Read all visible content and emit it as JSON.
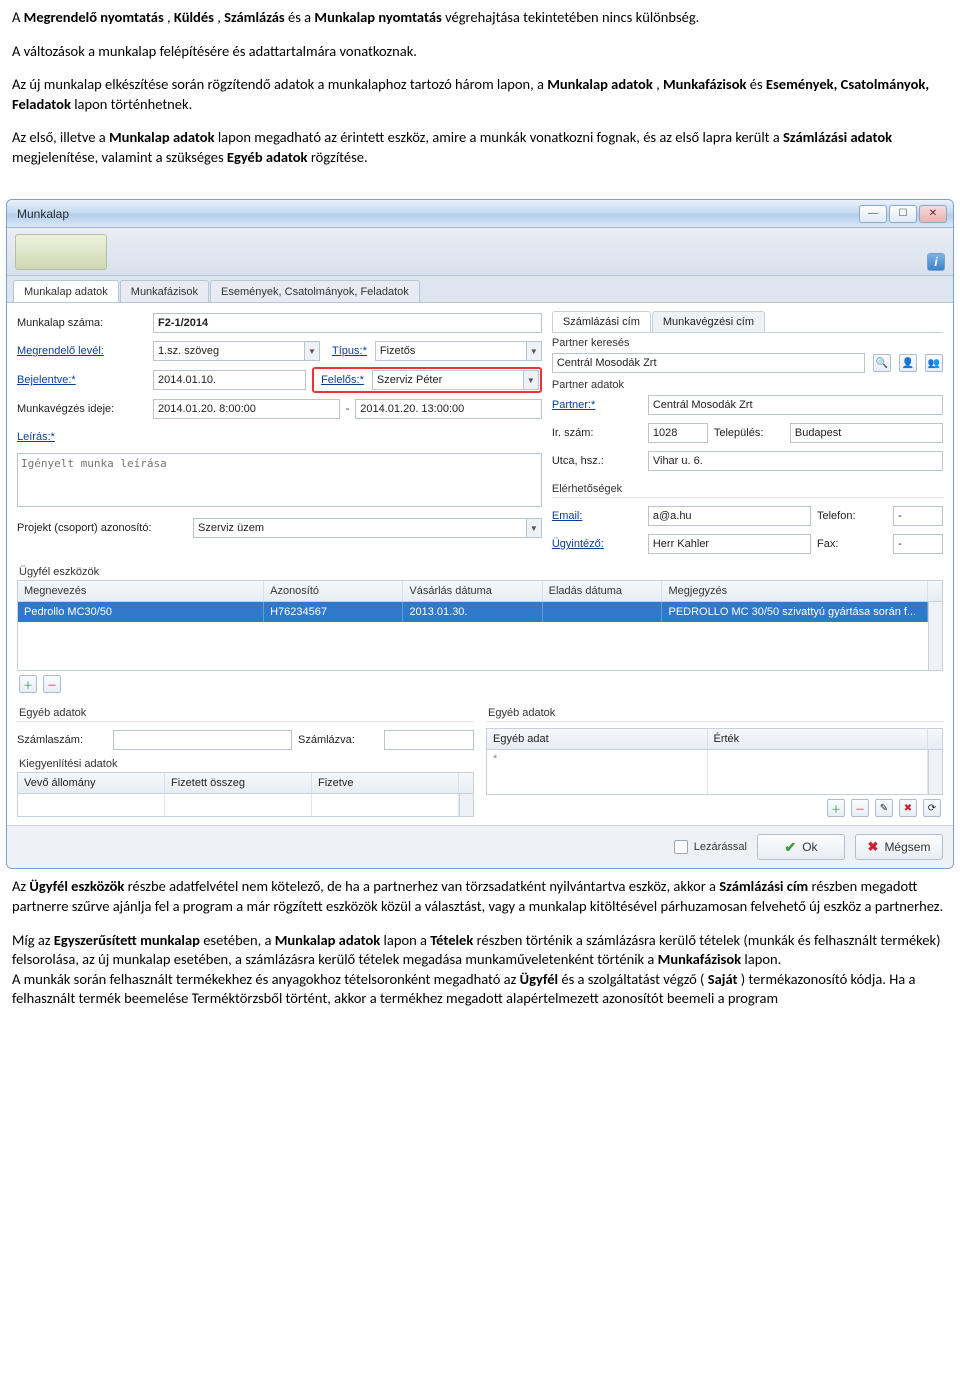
{
  "doc": {
    "p1_a": "A ",
    "p1_b1": "Megrendelő nyomtatás",
    "p1_c1": ", ",
    "p1_b2": "Küldés",
    "p1_c2": ", ",
    "p1_b3": "Számlázás",
    "p1_c3": " és a ",
    "p1_b4": "Munkalap nyomtatás",
    "p1_d": " végrehajtása tekintetében nincs különbség.",
    "p2": "A változások a munkalap felépítésére és adattartalmára vonatkoznak.",
    "p3_a": "Az új munkalap elkészítése során rögzítendő adatok a munkalaphoz tartozó három lapon, a ",
    "p3_b1": "Munkalap adatok",
    "p3_c1": ", ",
    "p3_b2": "Munkafázisok",
    "p3_c2": " és ",
    "p3_b3": "Események, Csatolmányok, Feladatok",
    "p3_d": " lapon történhetnek.",
    "p4_a": "Az első, illetve a ",
    "p4_b1": "Munkalap adatok",
    "p4_c1": " lapon megadható az érintett eszköz, amire a munkák vonatkozni fognak, és az első lapra került a ",
    "p4_b2": "Számlázási adatok",
    "p4_c2": " megjelenítése, valamint a szükséges ",
    "p4_b3": "Egyéb adatok",
    "p4_d": " rögzítése.",
    "p5_a": "Az ",
    "p5_b1": "Ügyfél eszközök",
    "p5_c1": " részbe adatfelvétel nem kötelező, de ha a partnerhez van törzsadatként nyilvántartva eszköz, akkor a ",
    "p5_b2": "Számlázási cím",
    "p5_d": " részben megadott partnerre szűrve ajánlja fel a program a már rögzített eszközök közül a választást, vagy a munkalap kitöltésével párhuzamosan felvehető új eszköz a partnerhez.",
    "p6_a": "Míg az ",
    "p6_b1": "Egyszerűsített munkalap",
    "p6_c1": " esetében, a ",
    "p6_b2": "Munkalap adatok",
    "p6_c2": " lapon a ",
    "p6_b3": "Tételek",
    "p6_c3": " részben történik a számlázásra kerülő tételek (munkák és felhasznált termékek) felsorolása, az új munkalap esetében, a számlázásra kerülő tételek megadása munkaműveletenként történik a ",
    "p6_b4": "Munkafázisok",
    "p6_d": " lapon.",
    "p7_a": "A munkák során felhasznált termékekhez és anyagokhoz tételsoronként megadható az ",
    "p7_b1": "Ügyfél",
    "p7_c1": " és a szolgáltatást végző (",
    "p7_b2": "Saját",
    "p7_c2": ") termékazonosító kódja. Ha a felhasznált termék beemelése Terméktörzsből történt, akkor a termékhez megadott alapértelmezett azonosítót beemeli a program"
  },
  "app": {
    "title": "Munkalap",
    "tabs": {
      "t1": "Munkalap adatok",
      "t2": "Munkafázisok",
      "t3": "Események, Csatolmányok, Feladatok"
    },
    "left": {
      "munkalap_szama_lbl": "Munkalap száma:",
      "munkalap_szama_val": "F2-1/2014",
      "megrendelo_lbl": "Megrendelő levél:",
      "megrendelo_val": "1.sz. szöveg",
      "tipus_lbl": "Típus:*",
      "tipus_val": "Fizetős",
      "bejelentve_lbl": "Bejelentve:*",
      "bejelentve_val": "2014.01.10.",
      "felelos_lbl": "Felelős:*",
      "felelos_val": "Szerviz Péter",
      "munkavegzes_lbl": "Munkavégzés ideje:",
      "munkavegzes_from": "2014.01.20. 8:00:00",
      "munkavegzes_sep": "-",
      "munkavegzes_to": "2014.01.20. 13:00:00",
      "leiras_lbl": "Leírás:*",
      "leiras_placeholder": "Igényelt munka leírása",
      "projekt_lbl": "Projekt (csoport) azonosító:",
      "projekt_val": "Szerviz üzem"
    },
    "right": {
      "sub_t1": "Számlázási cím",
      "sub_t2": "Munkavégzési cím",
      "partner_kereses": "Partner keresés",
      "partner_kereses_val": "Centrál Mosodák Zrt",
      "partner_adatok": "Partner adatok",
      "partner_lbl": "Partner:*",
      "partner_val": "Centrál Mosodák Zrt",
      "irszam_lbl": "Ir. szám:",
      "irszam_val": "1028",
      "telepules_lbl": "Település:",
      "telepules_val": "Budapest",
      "utca_lbl": "Utca, hsz.:",
      "utca_val": "Vihar u. 6.",
      "elerheto": "Elérhetőségek",
      "email_lbl": "Email:",
      "email_val": "a@a.hu",
      "telefon_lbl": "Telefon:",
      "telefon_val": "-",
      "ugyintezo_lbl": "Ügyintéző:",
      "ugyintezo_val": "Herr Kahler",
      "fax_lbl": "Fax:",
      "fax_val": "-"
    },
    "eszkozok": {
      "title": "Ügyfél eszközök",
      "columns": {
        "c1": "Megnevezés",
        "c2": "Azonosító",
        "c3": "Vásárlás dátuma",
        "c4": "Eladás dátuma",
        "c5": "Megjegyzés"
      },
      "row": {
        "c1": "Pedrollo MC30/50",
        "c2": "H76234567",
        "c3": "2013.01.30.",
        "c4": "",
        "c5": "PEDROLLO MC 30/50 szivattyú gyártása során f..."
      }
    },
    "egyeb_left": {
      "title": "Egyéb adatok",
      "szamlaszam_lbl": "Számlaszám:",
      "szamlazva_lbl": "Számlázva:",
      "kiegy_title": "Kiegyenlítési adatok",
      "col1": "Vevő állomány",
      "col2": "Fizetett összeg",
      "col3": "Fizetve"
    },
    "egyeb_right": {
      "title": "Egyéb adatok",
      "col1": "Egyéb adat",
      "col2": "Érték",
      "star": "*"
    },
    "footer": {
      "lezarassal": "Lezárással",
      "ok": "Ok",
      "megsem": "Mégsem"
    },
    "info_glyph": "i"
  }
}
